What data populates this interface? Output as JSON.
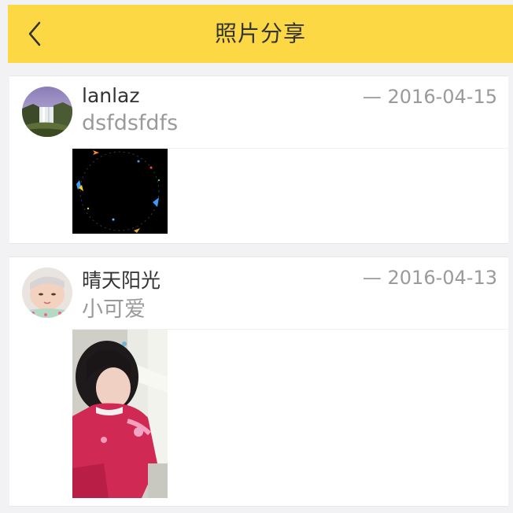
{
  "header": {
    "title": "照片分享",
    "back_icon": "chevron-left-icon",
    "background": "#fdd845"
  },
  "posts": [
    {
      "username": "lanlaz",
      "date": "— 2016-04-15",
      "caption": "dsfdsfdfs",
      "avatar_icon": "waterfall-photo-avatar",
      "photo": "black-image-with-paper-planes"
    },
    {
      "username": "晴天阳光",
      "date": "— 2016-04-13",
      "caption": "小可爱",
      "avatar_icon": "baby-photo-avatar",
      "photo": "child-in-red-outfit-photo"
    }
  ]
}
